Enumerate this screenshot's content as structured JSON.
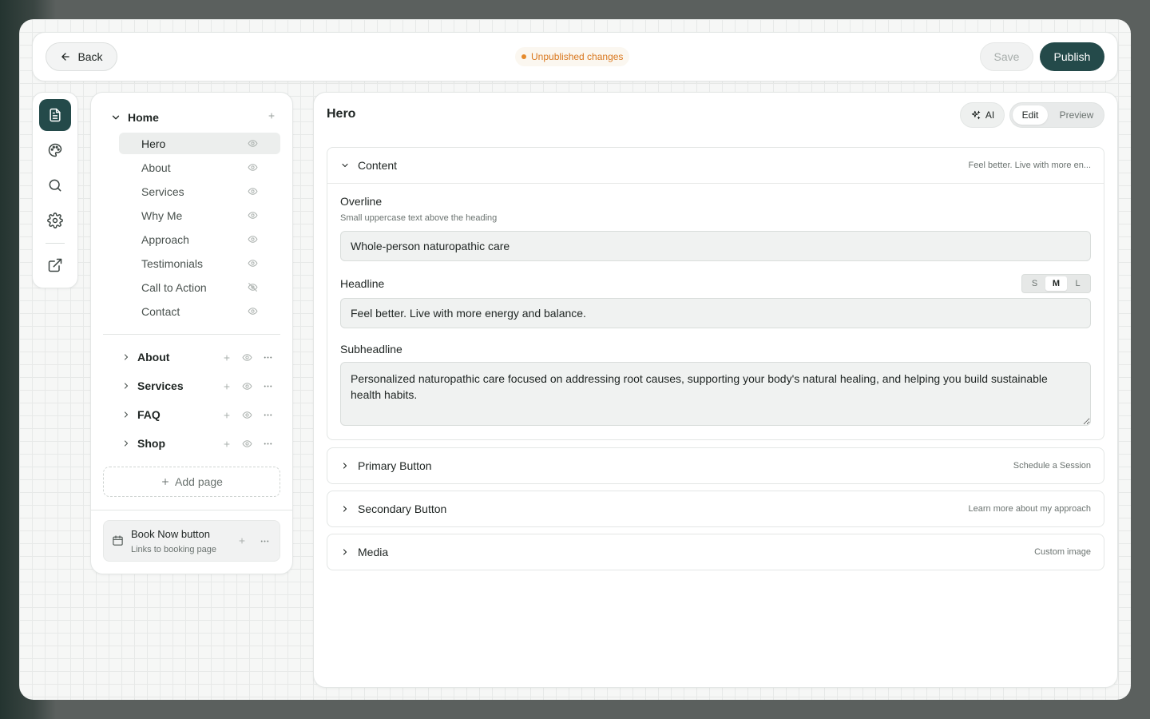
{
  "colors": {
    "accent": "#244a4a",
    "warning": "#d9771d",
    "muted_text": "#6b7370",
    "canvas": "#f6f7f6"
  },
  "topbar": {
    "back_label": "Back",
    "status_text": "Unpublished changes",
    "save_label": "Save",
    "publish_label": "Publish"
  },
  "rail": {
    "items": [
      {
        "icon": "page-icon",
        "active": true
      },
      {
        "icon": "palette-icon",
        "active": false
      },
      {
        "icon": "search-icon",
        "active": false
      },
      {
        "icon": "gear-icon",
        "active": false
      },
      {
        "icon": "external-link-icon",
        "active": false
      }
    ]
  },
  "sidebar": {
    "home": {
      "label": "Home",
      "sections": [
        {
          "label": "Hero",
          "active": true,
          "visible": true
        },
        {
          "label": "About",
          "active": false,
          "visible": true
        },
        {
          "label": "Services",
          "active": false,
          "visible": true
        },
        {
          "label": "Why Me",
          "active": false,
          "visible": true
        },
        {
          "label": "Approach",
          "active": false,
          "visible": true
        },
        {
          "label": "Testimonials",
          "active": false,
          "visible": true
        },
        {
          "label": "Call to Action",
          "active": false,
          "visible": false
        },
        {
          "label": "Contact",
          "active": false,
          "visible": true
        }
      ]
    },
    "pages": [
      {
        "label": "About"
      },
      {
        "label": "Services"
      },
      {
        "label": "FAQ"
      },
      {
        "label": "Shop"
      }
    ],
    "add_page_label": "Add page",
    "book_now": {
      "title": "Book Now button",
      "subtitle": "Links to booking page"
    }
  },
  "editor": {
    "title": "Hero",
    "ai_label": "AI",
    "mode_edit": "Edit",
    "mode_preview": "Preview",
    "content": {
      "title": "Content",
      "summary": "Feel better. Live with more en...",
      "overline_label": "Overline",
      "overline_help": "Small uppercase text above the heading",
      "overline_value": "Whole-person naturopathic care",
      "headline_label": "Headline",
      "headline_value": "Feel better. Live with more energy and balance.",
      "size_options": [
        "S",
        "M",
        "L"
      ],
      "size_selected": "M",
      "subheadline_label": "Subheadline",
      "subheadline_value": "Personalized naturopathic care focused on addressing root causes, supporting your body's natural healing, and helping you build sustainable health habits."
    },
    "primary_button": {
      "title": "Primary Button",
      "summary": "Schedule a Session"
    },
    "secondary_button": {
      "title": "Secondary Button",
      "summary": "Learn more about my approach"
    },
    "media": {
      "title": "Media",
      "summary": "Custom image"
    }
  }
}
